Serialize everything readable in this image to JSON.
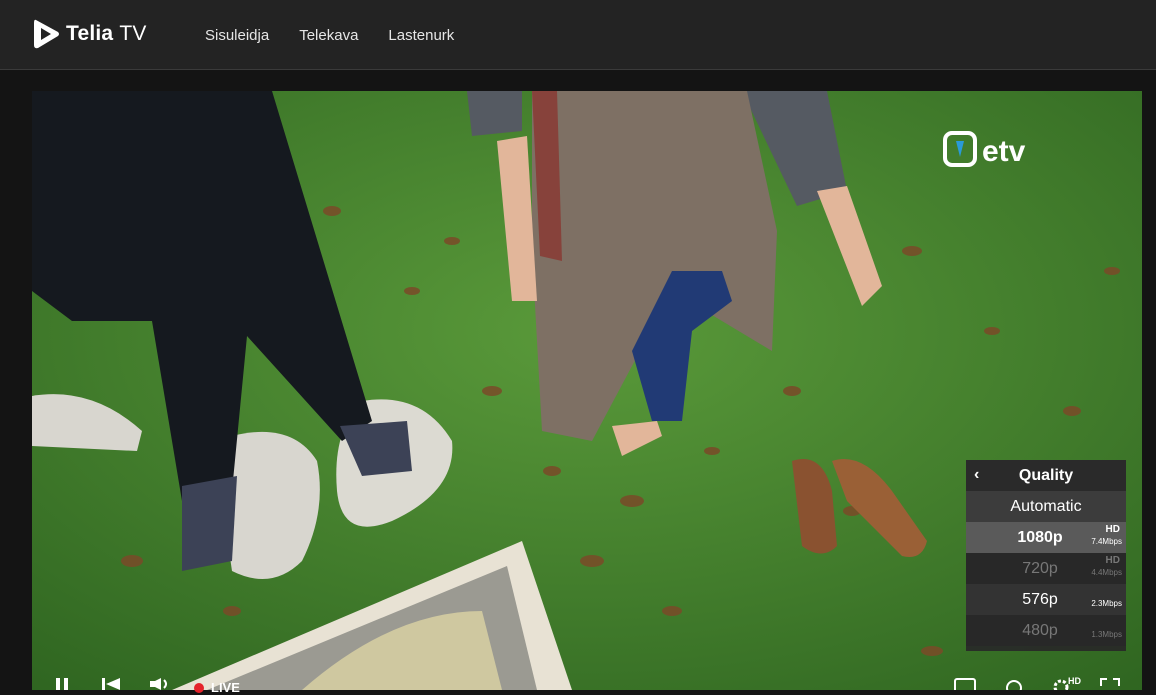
{
  "brand": {
    "name": "Telia",
    "suffix": "TV"
  },
  "nav": [
    {
      "label": "Sisuleidja"
    },
    {
      "label": "Telekava"
    },
    {
      "label": "Lastenurk"
    }
  ],
  "channel": {
    "logo_text": "etv"
  },
  "quality_menu": {
    "title": "Quality",
    "options": [
      {
        "label": "Automatic",
        "state": "normal"
      },
      {
        "label": "1080p",
        "hd": "HD",
        "rate": "7.4Mbps",
        "state": "selected"
      },
      {
        "label": "720p",
        "hd": "HD",
        "rate": "4.4Mbps",
        "state": "disabled"
      },
      {
        "label": "576p",
        "rate": "2.3Mbps",
        "state": "normal"
      },
      {
        "label": "480p",
        "rate": "1.3Mbps",
        "state": "disabled"
      }
    ]
  },
  "controls": {
    "live_label": "LIVE",
    "settings_badge": "HD"
  },
  "colors": {
    "live": "#e5222a",
    "topbar": "#232323"
  }
}
